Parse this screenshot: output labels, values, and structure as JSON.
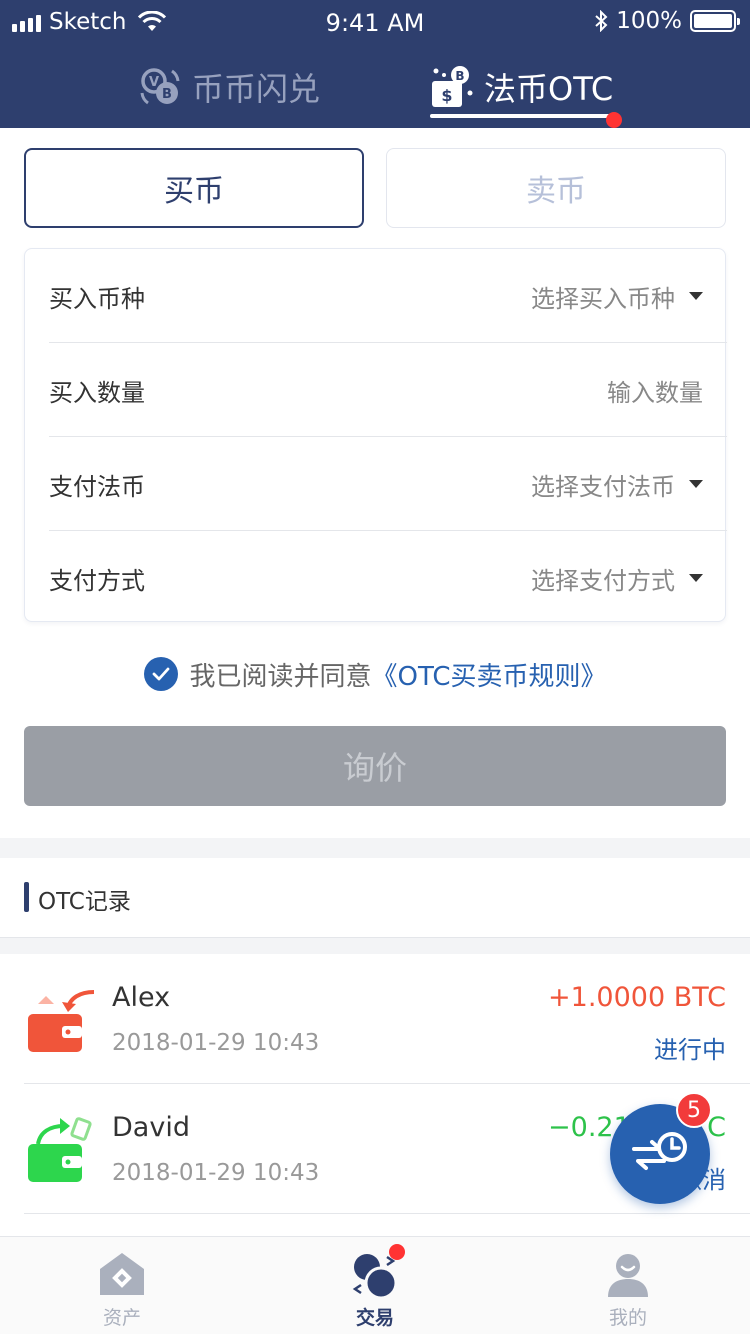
{
  "status_bar": {
    "carrier": "Sketch",
    "time": "9:41 AM",
    "battery": "100%"
  },
  "top_tabs": [
    {
      "label": "币币闪兑",
      "active": false
    },
    {
      "label": "法币OTC",
      "active": true,
      "has_dot": true
    }
  ],
  "trade_toggle": {
    "buy": "买币",
    "sell": "卖币",
    "selected": "buy"
  },
  "form": {
    "rows": [
      {
        "label": "买入币种",
        "value": "选择买入币种",
        "dropdown": true
      },
      {
        "label": "买入数量",
        "value": "输入数量",
        "dropdown": false
      },
      {
        "label": "支付法币",
        "value": "选择支付法币",
        "dropdown": true
      },
      {
        "label": "支付方式",
        "value": "选择支付方式",
        "dropdown": true
      }
    ]
  },
  "agreement": {
    "text": "我已阅读并同意",
    "link": "《OTC买卖币规则》",
    "checked": true
  },
  "inquire_button": "询价",
  "records": {
    "title": "OTC记录",
    "items": [
      {
        "name": "Alex",
        "date": "2018-01-29 10:43",
        "amount": "+1.0000 BTC",
        "status": "进行中",
        "type": "in",
        "amount_color": "#f0553a"
      },
      {
        "name": "David",
        "date": "2018-01-29 10:43",
        "amount": "−0.2100 BTC",
        "status": "已撤消",
        "type": "out",
        "amount_color": "#2dc24a"
      }
    ]
  },
  "fab": {
    "badge": "5"
  },
  "bottom_nav": [
    {
      "label": "资产",
      "active": false
    },
    {
      "label": "交易",
      "active": true,
      "has_dot": true
    },
    {
      "label": "我的",
      "active": false
    }
  ],
  "colors": {
    "primary": "#2e3f6e",
    "accent": "#2761b0",
    "positive": "#f0553a",
    "negative": "#2dc24a",
    "badge": "#f23b3b"
  }
}
